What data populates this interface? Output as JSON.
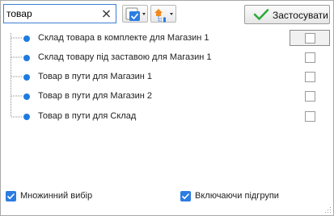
{
  "search": {
    "value": "товар"
  },
  "toolbar": {
    "apply_label": "Застосувати"
  },
  "tree": {
    "items": [
      {
        "label": "Склад товара в комплекте для Магазин 1",
        "checked": false
      },
      {
        "label": "Склад товару під заставою для Магазин 1",
        "checked": false
      },
      {
        "label": "Товар в пути для Магазин 1",
        "checked": false
      },
      {
        "label": "Товар в пути для Магазин 2",
        "checked": false
      },
      {
        "label": "Товар в пути для Склад",
        "checked": false
      }
    ]
  },
  "options": {
    "multi_select": {
      "label": "Множинний вибір",
      "checked": true
    },
    "include_subgroups": {
      "label": "Включаючи підгрупи",
      "checked": true
    }
  },
  "colors": {
    "accent": "#1e7be0",
    "check_green": "#2eaa3c"
  }
}
